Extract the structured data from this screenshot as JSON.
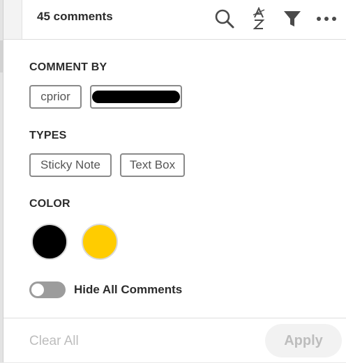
{
  "header": {
    "comment_count": "45 comments",
    "icons": [
      "search-icon",
      "sort-az-icon",
      "filter-icon",
      "more-options-icon"
    ]
  },
  "comment_by": {
    "title": "COMMENT BY",
    "authors": [
      "cprior"
    ]
  },
  "types": {
    "title": "TYPES",
    "items": [
      "Sticky Note",
      "Text Box"
    ]
  },
  "color": {
    "title": "COLOR",
    "swatches": [
      "#000000",
      "#ffcc00"
    ]
  },
  "hide_all": {
    "label": "Hide All Comments",
    "enabled": false
  },
  "footer": {
    "clear_all": "Clear All",
    "apply": "Apply"
  }
}
